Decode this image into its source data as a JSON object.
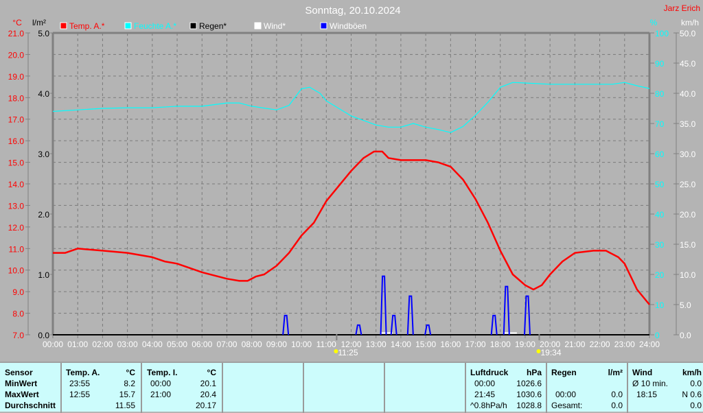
{
  "title": "Sonntag, 20.10.2024",
  "author": "Jarz Erich",
  "colors": {
    "temp": "#ff0000",
    "humidity": "#00ffff",
    "rain": "#000000",
    "wind": "#ffffff",
    "gust": "#0000ff",
    "background": "#b4b4b4",
    "panel": "#ccfcfc"
  },
  "chart_data": {
    "type": "line",
    "title": "Sonntag, 20.10.2024",
    "grid": true,
    "legend_placement": "top",
    "x_ticks": [
      "00:00",
      "01:00",
      "02:00",
      "03:00",
      "04:00",
      "05:00",
      "06:00",
      "07:00",
      "08:00",
      "09:00",
      "10:00",
      "11:00",
      "12:00",
      "13:00",
      "14:00",
      "15:00",
      "16:00",
      "17:00",
      "18:00",
      "19:00",
      "20:00",
      "21:00",
      "22:00",
      "23:00",
      "24:00"
    ],
    "axes": {
      "temp": {
        "unit": "°C",
        "range": [
          7,
          21
        ],
        "ticks": [
          "21.0",
          "20.0",
          "19.0",
          "18.0",
          "17.0",
          "16.0",
          "15.0",
          "14.0",
          "13.0",
          "12.0",
          "11.0",
          "10.0",
          "9.0",
          "8.0",
          "7.0"
        ]
      },
      "rain": {
        "unit": "l/m²",
        "range": [
          0,
          5
        ],
        "ticks": [
          "5.0",
          "4.0",
          "3.0",
          "2.0",
          "1.0",
          "0.0"
        ]
      },
      "humidity": {
        "unit": "%",
        "range": [
          0,
          100
        ],
        "ticks": [
          "100",
          "90",
          "80",
          "70",
          "60",
          "50",
          "40",
          "30",
          "20",
          "10",
          "0"
        ]
      },
      "wind": {
        "unit": "km/h",
        "range": [
          0,
          50
        ],
        "ticks": [
          "50.0",
          "45.0",
          "40.0",
          "35.0",
          "30.0",
          "25.0",
          "20.0",
          "15.0",
          "10.0",
          "5.0",
          "0.0"
        ]
      }
    },
    "legend": [
      "Temp. A.*",
      "Feuchte A.*",
      "Regen*",
      "Wind*",
      "Windböen"
    ],
    "series": [
      {
        "name": "Temp. A.*",
        "axis": "temp",
        "points": [
          [
            "00:00",
            10.8
          ],
          [
            "00:30",
            10.8
          ],
          [
            "01:00",
            11.0
          ],
          [
            "02:00",
            10.9
          ],
          [
            "03:00",
            10.8
          ],
          [
            "04:00",
            10.6
          ],
          [
            "04:30",
            10.4
          ],
          [
            "05:00",
            10.3
          ],
          [
            "05:30",
            10.1
          ],
          [
            "06:00",
            9.9
          ],
          [
            "07:00",
            9.6
          ],
          [
            "07:30",
            9.5
          ],
          [
            "07:50",
            9.5
          ],
          [
            "08:10",
            9.7
          ],
          [
            "08:30",
            9.8
          ],
          [
            "09:00",
            10.2
          ],
          [
            "09:30",
            10.8
          ],
          [
            "10:00",
            11.6
          ],
          [
            "10:30",
            12.2
          ],
          [
            "11:00",
            13.2
          ],
          [
            "11:30",
            13.9
          ],
          [
            "12:00",
            14.6
          ],
          [
            "12:30",
            15.2
          ],
          [
            "12:55",
            15.5
          ],
          [
            "13:15",
            15.5
          ],
          [
            "13:30",
            15.2
          ],
          [
            "14:00",
            15.1
          ],
          [
            "15:00",
            15.1
          ],
          [
            "15:30",
            15.0
          ],
          [
            "16:00",
            14.8
          ],
          [
            "16:30",
            14.2
          ],
          [
            "17:00",
            13.3
          ],
          [
            "17:30",
            12.2
          ],
          [
            "18:00",
            10.9
          ],
          [
            "18:30",
            9.8
          ],
          [
            "19:00",
            9.3
          ],
          [
            "19:20",
            9.1
          ],
          [
            "19:40",
            9.3
          ],
          [
            "20:00",
            9.8
          ],
          [
            "20:30",
            10.4
          ],
          [
            "21:00",
            10.8
          ],
          [
            "21:45",
            10.9
          ],
          [
            "22:15",
            10.9
          ],
          [
            "22:45",
            10.6
          ],
          [
            "23:00",
            10.3
          ],
          [
            "23:30",
            9.1
          ],
          [
            "24:00",
            8.4
          ]
        ]
      },
      {
        "name": "Feuchte A.*",
        "axis": "humidity",
        "points": [
          [
            "00:00",
            74
          ],
          [
            "01:00",
            74.5
          ],
          [
            "02:00",
            75
          ],
          [
            "03:00",
            75.2
          ],
          [
            "04:00",
            75.2
          ],
          [
            "05:00",
            75.7
          ],
          [
            "06:00",
            75.7
          ],
          [
            "07:00",
            76.8
          ],
          [
            "07:30",
            76.8
          ],
          [
            "08:00",
            75.7
          ],
          [
            "09:00",
            74.5
          ],
          [
            "09:30",
            76
          ],
          [
            "10:00",
            81.5
          ],
          [
            "10:20",
            82
          ],
          [
            "10:45",
            80
          ],
          [
            "11:00",
            77.5
          ],
          [
            "11:30",
            75
          ],
          [
            "12:00",
            72.5
          ],
          [
            "12:30",
            71
          ],
          [
            "13:00",
            69.5
          ],
          [
            "13:30",
            68.8
          ],
          [
            "14:00",
            68.8
          ],
          [
            "14:30",
            70
          ],
          [
            "15:00",
            68.8
          ],
          [
            "15:30",
            68
          ],
          [
            "16:00",
            67
          ],
          [
            "16:30",
            69
          ],
          [
            "17:00",
            72.7
          ],
          [
            "17:30",
            77
          ],
          [
            "18:00",
            82
          ],
          [
            "18:30",
            83.6
          ],
          [
            "19:00",
            83.4
          ],
          [
            "20:00",
            83
          ],
          [
            "21:00",
            83
          ],
          [
            "22:00",
            83
          ],
          [
            "22:30",
            83
          ],
          [
            "23:00",
            83.6
          ],
          [
            "23:30",
            82.5
          ],
          [
            "24:00",
            81.6
          ]
        ]
      },
      {
        "name": "Regen*",
        "axis": "rain",
        "points": [
          [
            "00:00",
            0
          ],
          [
            "24:00",
            0
          ]
        ]
      },
      {
        "name": "Wind*",
        "axis": "wind",
        "points": [
          [
            "13:10",
            0.3
          ],
          [
            "13:40",
            0.3
          ],
          [
            "18:10",
            0.3
          ],
          [
            "18:40",
            0.3
          ]
        ]
      },
      {
        "name": "Windböen",
        "axis": "wind",
        "spikes": [
          [
            "09:22",
            3.2
          ],
          [
            "12:18",
            1.6
          ],
          [
            "13:18",
            9.7
          ],
          [
            "13:43",
            3.2
          ],
          [
            "14:23",
            6.4
          ],
          [
            "15:05",
            1.6
          ],
          [
            "17:45",
            3.2
          ],
          [
            "18:15",
            8.0
          ],
          [
            "19:05",
            6.4
          ]
        ]
      }
    ],
    "annotations": {
      "sunrise": "11:25",
      "sunset": "19:34"
    }
  },
  "table": {
    "sensor": {
      "header": "Sensor",
      "rows": [
        "MinWert",
        "MaxWert",
        "Durchschnitt"
      ]
    },
    "temp_a": {
      "header": "Temp. A.",
      "unit": "°C",
      "min_time": "23:55",
      "min": "8.2",
      "max_time": "12:55",
      "max": "15.7",
      "avg": "11.55"
    },
    "temp_i": {
      "header": "Temp. I.",
      "unit": "°C",
      "min_time": "00:00",
      "min": "20.1",
      "max_time": "21:00",
      "max": "20.4",
      "avg": "20.17"
    },
    "pressure": {
      "header": "Luftdruck",
      "unit": "hPa",
      "r1_label": "00:00",
      "r1": "1026.6",
      "r2_label": "21:45",
      "r2": "1030.6",
      "r3_label": "^0.8hPa/h",
      "r3": "1028.8"
    },
    "rain": {
      "header": "Regen",
      "unit": "l/m²",
      "r2_label": "00:00",
      "r2": "0.0",
      "r3_label": "Gesamt:",
      "r3": "0.0"
    },
    "wind": {
      "header": "Wind",
      "unit": "km/h",
      "r1_label": "Ø 10 min.",
      "r1": "0.0",
      "r2_label": "18:15",
      "r2": "N 0.6",
      "r3": "0.0"
    }
  }
}
